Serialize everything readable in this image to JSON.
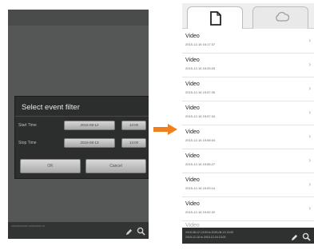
{
  "left": {
    "dialog_title": "Select event filter",
    "start_label": "Start Time",
    "start_date": "2015-08-12",
    "start_time": "13:00",
    "end_label": "Stop Time",
    "end_date": "2015-08-13",
    "end_time": "13:00",
    "ok_label": "OK",
    "cancel_label": "Cancel",
    "status_text": "xxxxxxxxxxxx xxxxxxxxx xx"
  },
  "right": {
    "items": [
      {
        "title": "Video",
        "date": "2015-12-16 16:17:37"
      },
      {
        "title": "Video",
        "date": "2015-12-16 16:05:03"
      },
      {
        "title": "Video",
        "date": "2015-12-16 15:57:35"
      },
      {
        "title": "Video",
        "date": "2015-12-16 15:57:34"
      },
      {
        "title": "Video",
        "date": "2015-12-16 15:58:04"
      },
      {
        "title": "Video",
        "date": "2015-12-16 15:56:27"
      },
      {
        "title": "Video",
        "date": "2015-12-16 15:53:14"
      },
      {
        "title": "Video",
        "date": "2015-12-16 15:52:32"
      },
      {
        "title": "Video",
        "date": ""
      }
    ],
    "status_line1": "2015-08-12 13:00 to 2015-08-13 13:00",
    "status_line2": "2015-12-16 to 2015-12-16 13:00"
  },
  "colors": {
    "arrow": "#f07f1e",
    "dialog_bg": "#2c2d2d",
    "screen_bg": "#555757"
  }
}
